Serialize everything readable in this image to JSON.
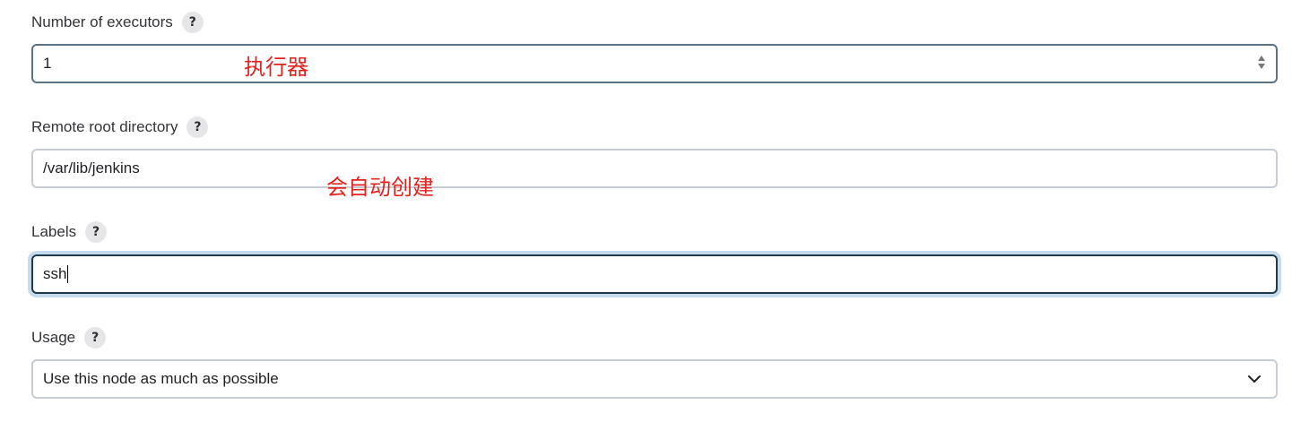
{
  "executors": {
    "label": "Number of executors",
    "help": "?",
    "value": "1",
    "annotation": "执行器"
  },
  "remote_root": {
    "label": "Remote root directory",
    "help": "?",
    "value": "/var/lib/jenkins",
    "annotation": "会自动创建"
  },
  "labels": {
    "label": "Labels",
    "help": "?",
    "value": "ssh"
  },
  "usage": {
    "label": "Usage",
    "help": "?",
    "selected": "Use this node as much as possible"
  },
  "colors": {
    "annotation": "#e4231e",
    "focus_ring": "#c5dbeb"
  }
}
